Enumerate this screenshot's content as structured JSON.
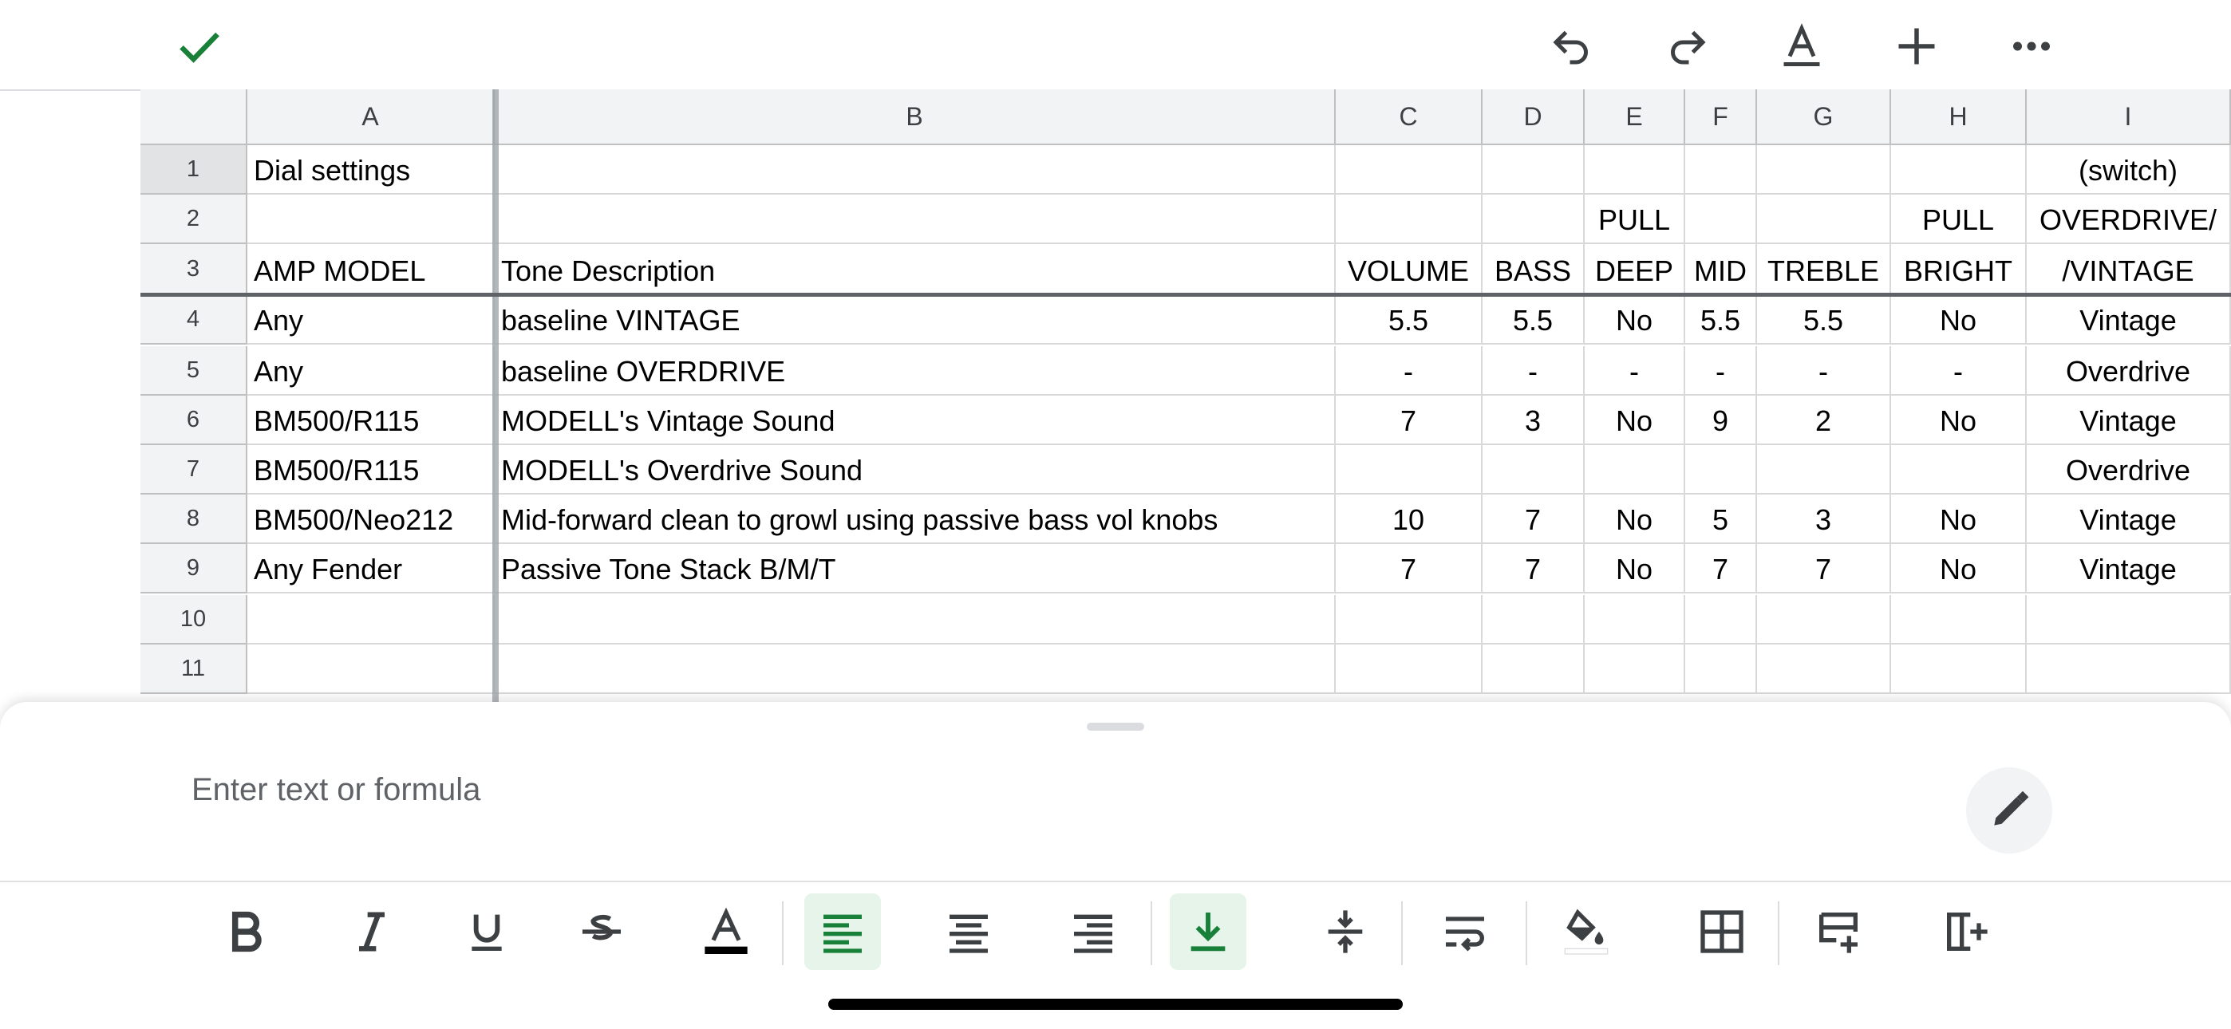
{
  "toolbar": {
    "icons": [
      "check-icon",
      "undo-icon",
      "redo-icon",
      "text-format-icon",
      "insert-icon",
      "more-icon"
    ]
  },
  "columns": [
    "A",
    "B",
    "C",
    "D",
    "E",
    "F",
    "G",
    "H",
    "I"
  ],
  "rows": [
    {
      "num": "1",
      "cells": [
        "Dial settings",
        "",
        "",
        "",
        "",
        "",
        "",
        "",
        "(switch)"
      ]
    },
    {
      "num": "2",
      "cells": [
        "",
        "",
        "",
        "",
        "PULL",
        "",
        "",
        "PULL",
        "OVERDRIVE/"
      ]
    },
    {
      "num": "3",
      "cells": [
        "AMP MODEL",
        "Tone Description",
        "VOLUME",
        "BASS",
        "DEEP",
        "MID",
        "TREBLE",
        "BRIGHT",
        "/VINTAGE"
      ]
    },
    {
      "num": "4",
      "cells": [
        "Any",
        "baseline VINTAGE",
        "5.5",
        "5.5",
        "No",
        "5.5",
        "5.5",
        "No",
        "Vintage"
      ]
    },
    {
      "num": "5",
      "cells": [
        "Any",
        "baseline OVERDRIVE",
        "-",
        "-",
        "-",
        "-",
        "-",
        "-",
        "Overdrive"
      ]
    },
    {
      "num": "6",
      "cells": [
        "BM500/R115",
        "MODELL's Vintage Sound",
        "7",
        "3",
        "No",
        "9",
        "2",
        "No",
        "Vintage"
      ]
    },
    {
      "num": "7",
      "cells": [
        "BM500/R115",
        "MODELL's Overdrive Sound",
        "",
        "",
        "",
        "",
        "",
        "",
        "Overdrive"
      ]
    },
    {
      "num": "8",
      "cells": [
        "BM500/Neo212",
        "Mid-forward clean to growl using passive bass vol knobs",
        "10",
        "7",
        "No",
        "5",
        "3",
        "No",
        "Vintage"
      ]
    },
    {
      "num": "9",
      "cells": [
        "Any Fender",
        "Passive Tone Stack B/M/T",
        "7",
        "7",
        "No",
        "7",
        "7",
        "No",
        "Vintage"
      ]
    },
    {
      "num": "10",
      "cells": [
        "",
        "",
        "",
        "",
        "",
        "",
        "",
        "",
        ""
      ]
    },
    {
      "num": "11",
      "cells": [
        "",
        "",
        "",
        "",
        "",
        "",
        "",
        "",
        ""
      ]
    }
  ],
  "formula_bar": {
    "placeholder": "Enter text or formula"
  },
  "format_toolbar": {
    "items": [
      "bold-icon",
      "italic-icon",
      "underline-icon",
      "strikethrough-icon",
      "text-color-icon",
      "align-left-icon",
      "align-center-icon",
      "align-right-icon",
      "valign-bottom-icon",
      "valign-middle-icon",
      "wrap-text-icon",
      "fill-color-icon",
      "borders-icon",
      "insert-row-icon",
      "insert-column-icon"
    ],
    "active": [
      "align-left-icon",
      "valign-bottom-icon"
    ]
  },
  "colors": {
    "accent": "#188038",
    "active_bg": "#e6f4ea",
    "header_bg": "#f1f3f4"
  }
}
